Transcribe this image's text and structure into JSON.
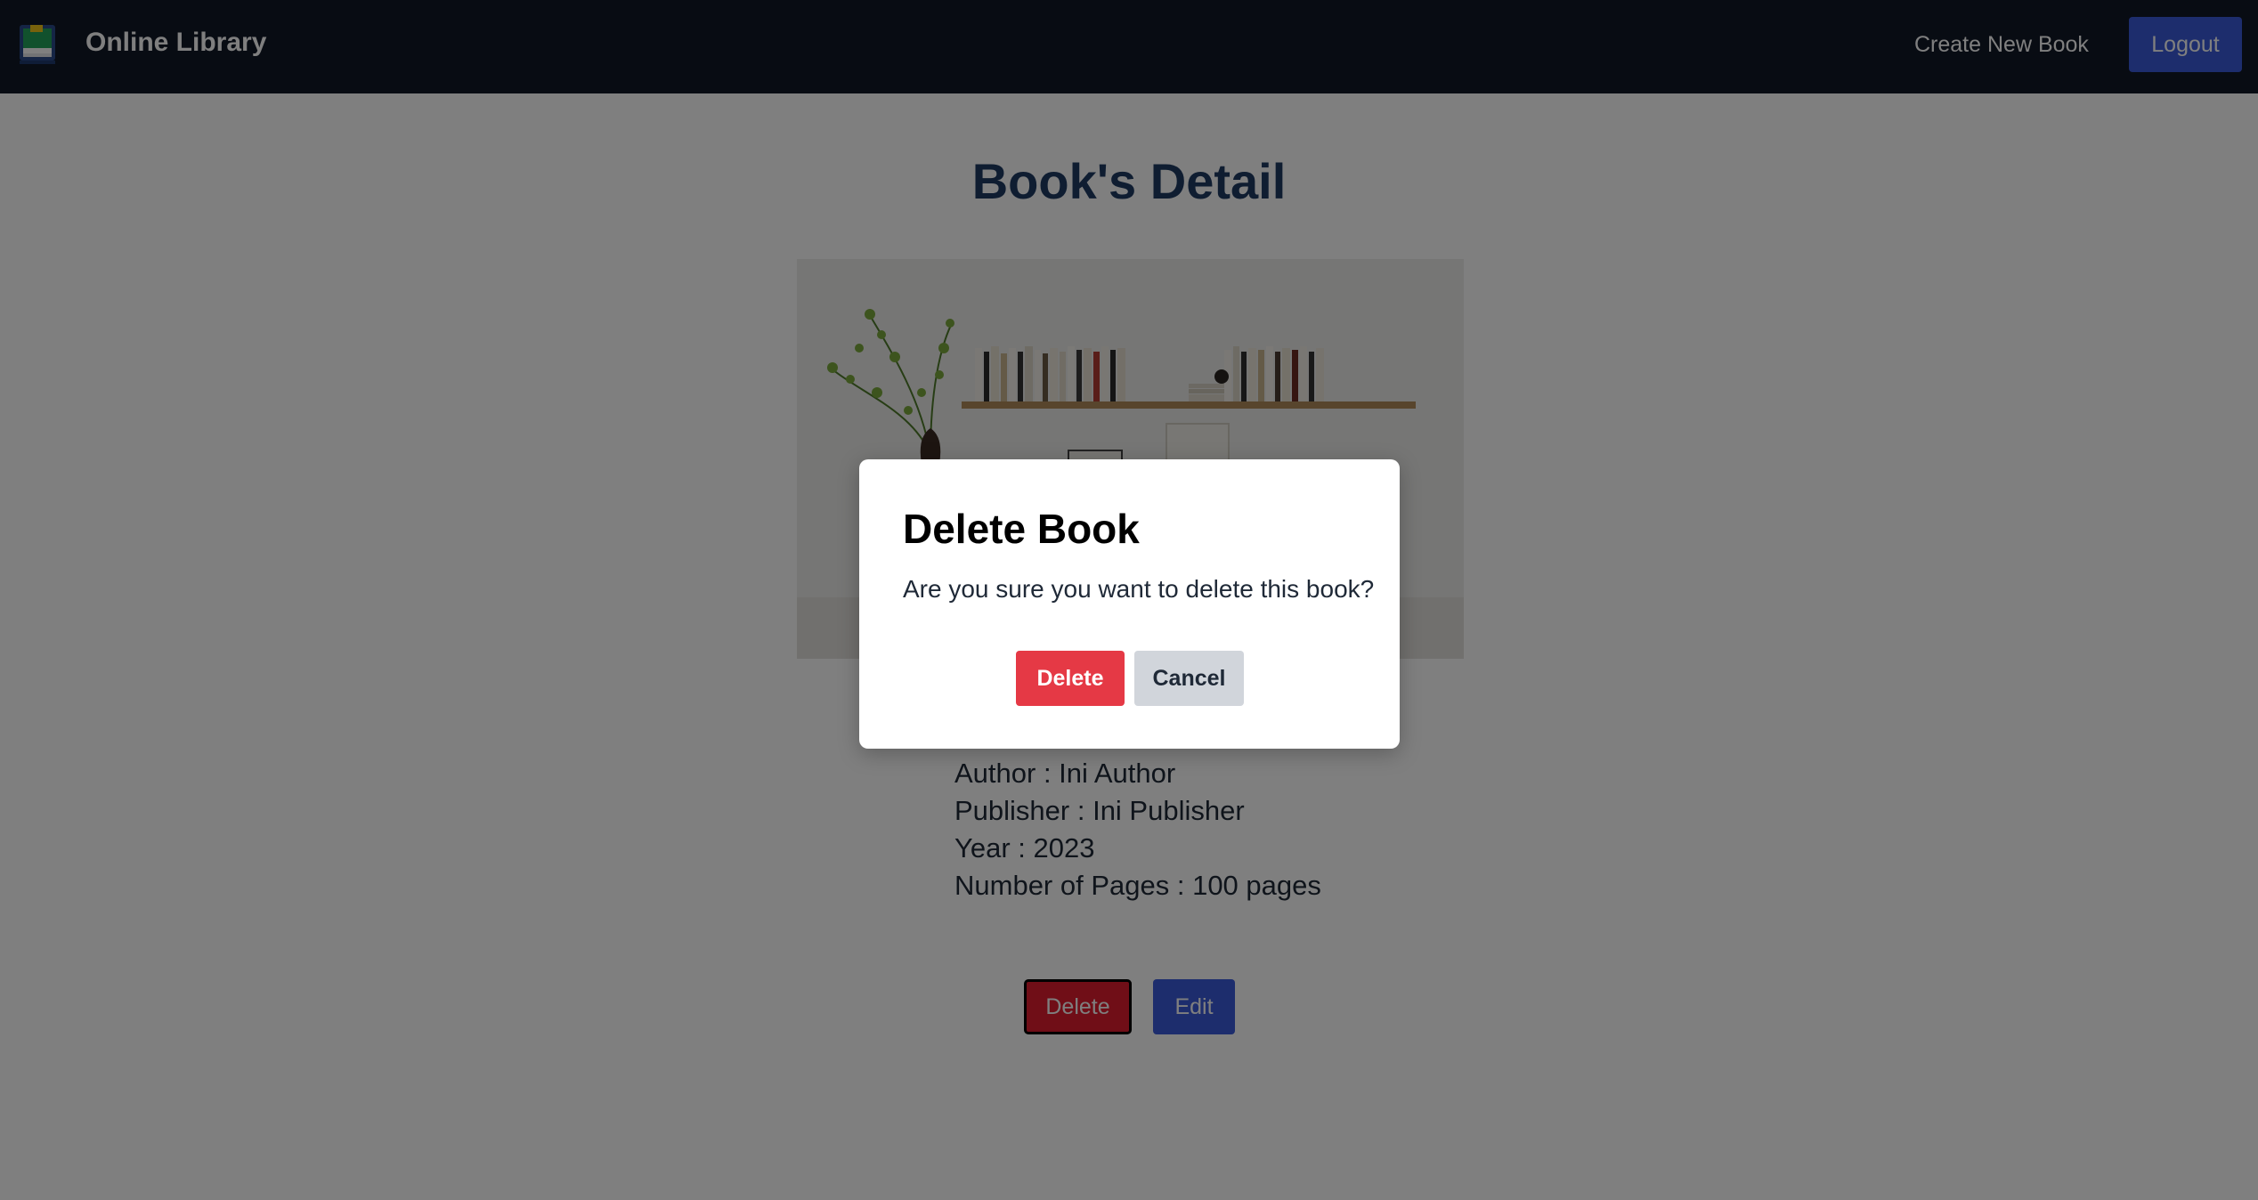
{
  "navbar": {
    "logo_icon": "book-stack-icon",
    "brand": "Online Library",
    "create_link": "Create New Book",
    "logout_label": "Logout"
  },
  "main": {
    "title": "Book's Detail",
    "image_description_icon": "bookshelf-photo",
    "details": {
      "author": "Author : Ini Author",
      "publisher": "Publisher : Ini Publisher",
      "year": "Year : 2023",
      "pages": "Number of Pages : 100 pages"
    },
    "delete_label": "Delete",
    "edit_label": "Edit"
  },
  "modal": {
    "title": "Delete Book",
    "message": "Are you sure you want to delete this book?",
    "confirm_label": "Delete",
    "cancel_label": "Cancel"
  },
  "colors": {
    "navbar_bg": "#111827",
    "primary": "#3b5bdb",
    "danger": "#e53945",
    "overlay": "rgba(0,0,0,0.5)"
  }
}
